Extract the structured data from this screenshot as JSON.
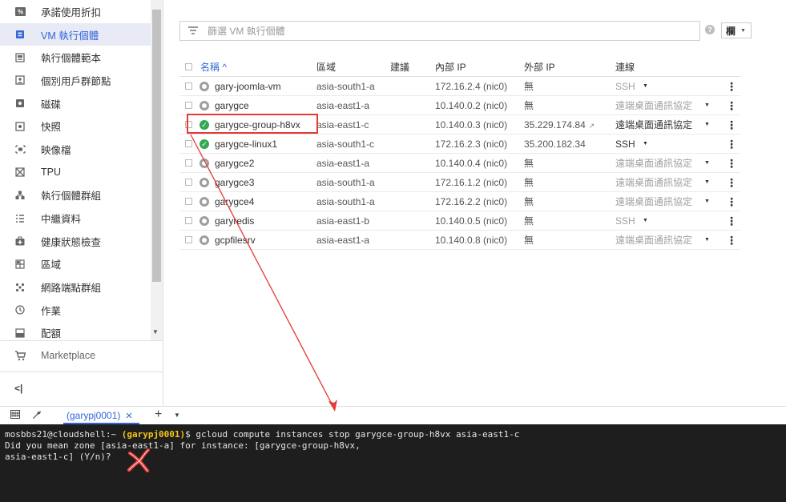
{
  "sidebar": {
    "items": [
      {
        "label": "承諾使用折扣",
        "icon": "percent-icon",
        "active": false
      },
      {
        "label": "VM 執行個體",
        "icon": "vm-instance-icon",
        "active": true
      },
      {
        "label": "執行個體範本",
        "icon": "template-icon",
        "active": false
      },
      {
        "label": "個別用戶群節點",
        "icon": "sole-tenant-icon",
        "active": false
      },
      {
        "label": "磁碟",
        "icon": "disk-icon",
        "active": false
      },
      {
        "label": "快照",
        "icon": "snapshot-icon",
        "active": false
      },
      {
        "label": "映像檔",
        "icon": "image-icon",
        "active": false
      },
      {
        "label": "TPU",
        "icon": "tpu-icon",
        "active": false
      },
      {
        "label": "執行個體群組",
        "icon": "instance-group-icon",
        "active": false
      },
      {
        "label": "中繼資料",
        "icon": "metadata-icon",
        "active": false
      },
      {
        "label": "健康狀態檢查",
        "icon": "health-check-icon",
        "active": false
      },
      {
        "label": "區域",
        "icon": "zone-icon",
        "active": false
      },
      {
        "label": "網路端點群組",
        "icon": "network-endpoint-icon",
        "active": false
      },
      {
        "label": "作業",
        "icon": "operations-icon",
        "active": false
      },
      {
        "label": "配額",
        "icon": "quota-icon",
        "active": false
      }
    ],
    "marketplace_label": "Marketplace",
    "collapse_label": "<|"
  },
  "filter": {
    "placeholder": "篩選 VM 執行個體",
    "columns_label": "欄"
  },
  "table": {
    "headers": {
      "name": "名稱 ^",
      "zone": "區域",
      "recommendation": "建議",
      "internal_ip": "內部 IP",
      "external_ip": "外部 IP",
      "connect": "連線"
    },
    "rows": [
      {
        "name": "gary-joomla-vm",
        "status": "stopped",
        "zone": "asia-south1-a",
        "internal_ip": "172.16.2.4 (nic0)",
        "external_ip": "無",
        "connect": "SSH",
        "connect_enabled": false
      },
      {
        "name": "garygce",
        "status": "stopped",
        "zone": "asia-east1-a",
        "internal_ip": "10.140.0.2 (nic0)",
        "external_ip": "無",
        "connect": "遠端桌面通訊協定",
        "connect_enabled": false
      },
      {
        "name": "garygce-group-h8vx",
        "status": "running",
        "zone": "asia-east1-c",
        "internal_ip": "10.140.0.3 (nic0)",
        "external_ip": "35.229.174.84",
        "connect": "遠端桌面通訊協定",
        "connect_enabled": true
      },
      {
        "name": "garygce-linux1",
        "status": "running",
        "zone": "asia-south1-c",
        "internal_ip": "172.16.2.3 (nic0)",
        "external_ip": "35.200.182.34",
        "connect": "SSH",
        "connect_enabled": true
      },
      {
        "name": "garygce2",
        "status": "stopped",
        "zone": "asia-east1-a",
        "internal_ip": "10.140.0.4 (nic0)",
        "external_ip": "無",
        "connect": "遠端桌面通訊協定",
        "connect_enabled": false
      },
      {
        "name": "garygce3",
        "status": "stopped",
        "zone": "asia-south1-a",
        "internal_ip": "172.16.1.2 (nic0)",
        "external_ip": "無",
        "connect": "遠端桌面通訊協定",
        "connect_enabled": false
      },
      {
        "name": "garygce4",
        "status": "stopped",
        "zone": "asia-south1-a",
        "internal_ip": "172.16.2.2 (nic0)",
        "external_ip": "無",
        "connect": "遠端桌面通訊協定",
        "connect_enabled": false
      },
      {
        "name": "garyredis",
        "status": "stopped",
        "zone": "asia-east1-b",
        "internal_ip": "10.140.0.5 (nic0)",
        "external_ip": "無",
        "connect": "SSH",
        "connect_enabled": false
      },
      {
        "name": "gcpfilesrv",
        "status": "stopped",
        "zone": "asia-east1-a",
        "internal_ip": "10.140.0.8 (nic0)",
        "external_ip": "無",
        "connect": "遠端桌面通訊協定",
        "connect_enabled": false
      }
    ]
  },
  "shell": {
    "tab_label": "(garypj0001)",
    "tab_close": "✕",
    "add_label": "+",
    "terminal": {
      "user_host": "mosbbs21@cloudshell:~",
      "project": "(garypj0001)",
      "command": "$ gcloud compute instances stop garygce-group-h8vx asia-east1-c",
      "line2": "Did you mean zone [asia-east1-a] for instance: [garygce-group-h8vx,",
      "line3": "asia-east1-c] (Y/n)?"
    }
  },
  "colors": {
    "accent": "#3367d6",
    "running": "#34a853",
    "annotation_red": "#e53935",
    "terminal_bg": "#1e1e1e",
    "project_yellow": "#f5c518"
  }
}
